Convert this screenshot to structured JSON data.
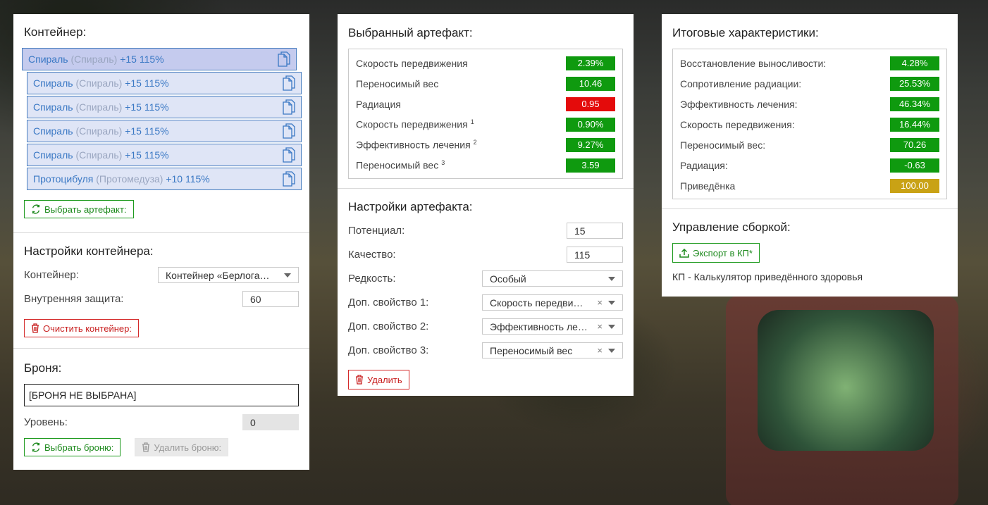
{
  "colors": {
    "green": "#0f9a0f",
    "red": "#e40b0b",
    "gold": "#c9a215",
    "blue": "#3a78c4"
  },
  "container_panel": {
    "title": "Контейнер:",
    "artifacts": [
      {
        "name": "Спираль",
        "sub": "(Спираль)",
        "value": "+15 115%",
        "active": true
      },
      {
        "name": "Спираль",
        "sub": "(Спираль)",
        "value": "+15 115%"
      },
      {
        "name": "Спираль",
        "sub": "(Спираль)",
        "value": "+15 115%"
      },
      {
        "name": "Спираль",
        "sub": "(Спираль)",
        "value": "+15 115%"
      },
      {
        "name": "Спираль",
        "sub": "(Спираль)",
        "value": "+15 115%"
      },
      {
        "name": "Протоцибуля",
        "sub": "(Протомедуза)",
        "value": "+10 115%"
      }
    ],
    "select_artifact_btn": "Выбрать артефакт:",
    "settings_title": "Настройки контейнера:",
    "container_label": "Контейнер:",
    "container_value": "Контейнер «Берлога…",
    "inner_protection_label": "Внутренняя защита:",
    "inner_protection_value": "60",
    "clear_btn": "Очистить контейнер:",
    "armor_title": "Броня:",
    "armor_value": "[БРОНЯ НЕ ВЫБРАНА]",
    "level_label": "Уровень:",
    "level_value": "0",
    "select_armor_btn": "Выбрать броню:",
    "delete_armor_btn": "Удалить броню:"
  },
  "artifact_panel": {
    "title": "Выбранный артефакт:",
    "stats": [
      {
        "label": "Скорость передвижения",
        "sup": "",
        "value": "2.39%",
        "color": "green"
      },
      {
        "label": "Переносимый вес",
        "sup": "",
        "value": "10.46",
        "color": "green"
      },
      {
        "label": "Радиация",
        "sup": "",
        "value": "0.95",
        "color": "red"
      },
      {
        "label": "Скорость передвижения",
        "sup": "1",
        "value": "0.90%",
        "color": "green"
      },
      {
        "label": "Эффективность лечения",
        "sup": "2",
        "value": "9.27%",
        "color": "green"
      },
      {
        "label": "Переносимый вес",
        "sup": "3",
        "value": "3.59",
        "color": "green"
      }
    ],
    "settings_title": "Настройки артефакта:",
    "potential_label": "Потенциал:",
    "potential_value": "15",
    "quality_label": "Качество:",
    "quality_value": "115",
    "rarity_label": "Редкость:",
    "rarity_value": "Особый",
    "extra1_label": "Доп. свойство 1:",
    "extra1_value": "Скорость передви…",
    "extra2_label": "Доп. свойство 2:",
    "extra2_value": "Эффективность ле…",
    "extra3_label": "Доп. свойство 3:",
    "extra3_value": "Переносимый вес",
    "delete_btn": "Удалить"
  },
  "totals_panel": {
    "title": "Итоговые характеристики:",
    "stats": [
      {
        "label": "Восстановление выносливости:",
        "value": "4.28%",
        "color": "green"
      },
      {
        "label": "Сопротивление радиации:",
        "value": "25.53%",
        "color": "green"
      },
      {
        "label": "Эффективность лечения:",
        "value": "46.34%",
        "color": "green"
      },
      {
        "label": "Скорость передвижения:",
        "value": "16.44%",
        "color": "green"
      },
      {
        "label": "Переносимый вес:",
        "value": "70.26",
        "color": "green"
      },
      {
        "label": "Радиация:",
        "value": "-0.63",
        "color": "green"
      },
      {
        "label": "Приведёнка",
        "value": "100.00",
        "color": "gold"
      }
    ],
    "build_title": "Управление сборкой:",
    "export_btn": "Экспорт в КП*",
    "footnote": "КП - Калькулятор приведённого здоровья"
  }
}
